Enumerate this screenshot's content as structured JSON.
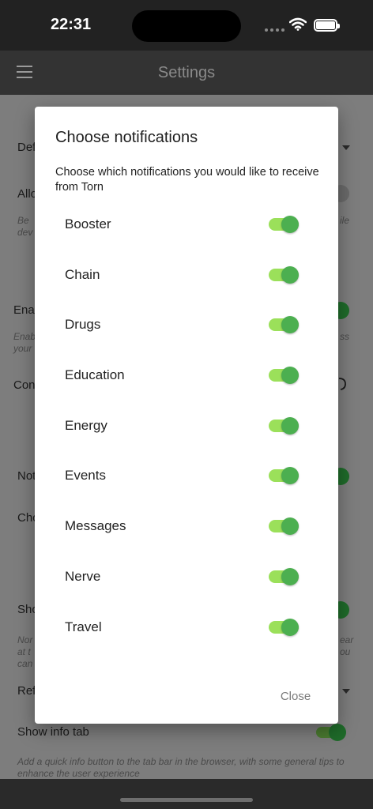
{
  "status_bar": {
    "time": "22:31"
  },
  "app_bar": {
    "title": "Settings"
  },
  "background": {
    "row1": "Def",
    "row2": "Allo",
    "row2_desc": "Be",
    "row2_desc_b": "dev",
    "row2_desc_right": "ile",
    "row3": "Ena",
    "row3_desc": "Enab",
    "row3_desc_b": "your",
    "row3_desc_right": "ss",
    "row4": "Con",
    "row5": "Not",
    "row6": "Cho",
    "row7": "Sho",
    "row7_desc": "Nor",
    "row7_desc_b": "at t",
    "row7_desc_c": "can",
    "row7_desc_right": "ear",
    "row7_desc_right_b": "ou",
    "row8": "Ref",
    "info_tab_label": "Show info tab",
    "info_tab_desc": "Add a quick info button to the tab bar in the browser, with some general tips to enhance the user experience"
  },
  "dialog": {
    "title": "Choose notifications",
    "subtitle": "Choose which notifications you would like to receive from Torn",
    "items": [
      {
        "label": "Booster",
        "enabled": true
      },
      {
        "label": "Chain",
        "enabled": true
      },
      {
        "label": "Drugs",
        "enabled": true
      },
      {
        "label": "Education",
        "enabled": true
      },
      {
        "label": "Energy",
        "enabled": true
      },
      {
        "label": "Events",
        "enabled": true
      },
      {
        "label": "Messages",
        "enabled": true
      },
      {
        "label": "Nerve",
        "enabled": true
      },
      {
        "label": "Travel",
        "enabled": true
      }
    ],
    "close_label": "Close"
  },
  "colors": {
    "switch_track": "#9be05a",
    "switch_thumb": "#4caf50"
  }
}
